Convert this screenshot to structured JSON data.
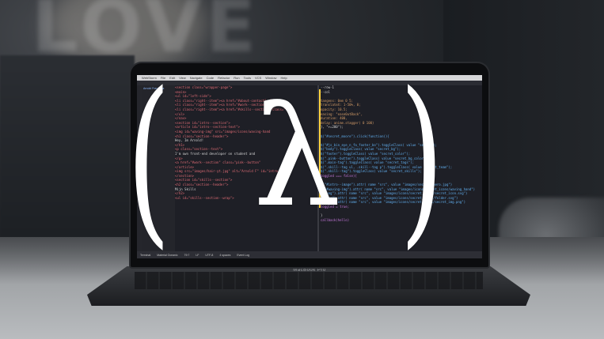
{
  "overlay": {
    "open_paren": "(",
    "lambda": "λ",
    "close_paren": ")"
  },
  "laptop": {
    "brand": "MacBook Pro"
  },
  "editor": {
    "menu": [
      "WebStorm",
      "File",
      "Edit",
      "View",
      "Navigate",
      "Code",
      "Refactor",
      "Run",
      "Tools",
      "VCS",
      "Window",
      "Help"
    ],
    "project_label": "Arnold Francisca",
    "left_code": [
      "<section class=\"wrapper-page\">",
      "  <main>",
      "    <ul id=\"left-side\">",
      "      <li class=\"right--item\"><a href=\"#about-contact\" class=\"",
      "      <li class=\"right--item\"><a href=\"#work--section\" class=\"",
      "      <li class=\"right--item\"><a href=\"#skills--section\" class=\"",
      "    </ul>",
      "  </nav>",
      "  <section id=\"intro--section\">",
      "    <article id=\"intro--section-text\">",
      "      <img id=\"waving-img\" src=\"images/icons/waving-hand",
      "      <h1 class=\"section--header\">",
      "        Hey, Im Arnold!",
      "      </h1>",
      "      <p class=\"section--text\">",
      "        I'm own front-end developer on student and",
      "      </p>",
      "      <a href=\"#work--section\" class=\"pink--button\"",
      "    </article>",
      "    <img src=\"images/hair-yt.jpg\" alt=\"Arnold F\" id=\"intro--image",
      "  </section>",
      "  <section id=\"skills--section\">",
      "    <h2 class=\"section--header\">",
      "      Mijn Skills",
      "    </h2>",
      "    <ul id=\"skills--section--wrap\">"
    ],
    "right_code": [
      "  --row-1",
      "  --col",
      "",
      "  tangens: 0em 0 5;",
      "  translateX: 1-50%, 0;",
      "  opacity: 10.5;",
      "  easing: \"ease0utBack\",",
      "  duration: 400,",
      "  delay: anime.stagger( 0 100)",
      "}, \"+=200\");",
      "",
      "$(\"#secret_moore\").click(function(){",
      "",
      "  $(\"#js_bin_eye_n_fa_footer_bo\").toggleClass( value \"secret\");",
      "  $(\"body\").toggleClass( value \"secret_bg\");",
      "  $(\"footer\").toggleClass( value \"secret_color\");",
      "  $(\".pink--button\").toggleClass( value \"secret_bg_color\");",
      "  $(\".main-tag\").toggleClass( value \"secret_tags\");",
      "  $(\".skill--tag ul, .skill--tag p\").toggleClass( value \"secret_team\");",
      "  $(\".skill--tag\").toggleClass( value \"secret_skills\");",
      "  toggled === false){",
      "",
      "  $(\"#intro--image\").attr( name \"src\", value \"images/secret--hero.jpg\")",
      "  $(\"#waving-img\").attr( name \"src\", value \"images/icons/secret_icons/waving_hand\")",
      "  $(\"img\").attr( name \"src\", value \"images/icons/secret_icons/secret_icon.svg\")",
      "  $(\"img\").attr( name \"src\", value \"images/icons/secret_icons/folder.svg\")",
      "  $(\"img\").attr( name \"src\", value \"images/icons/secret_icons/secret_img.png\")",
      "  toggled = true;",
      "",
      "}",
      "callback(hello)"
    ],
    "status": [
      "Terminal",
      "Material Oceanic",
      "79:7",
      "LF",
      "UTF-8",
      "4 spaces",
      "Event Log"
    ]
  }
}
